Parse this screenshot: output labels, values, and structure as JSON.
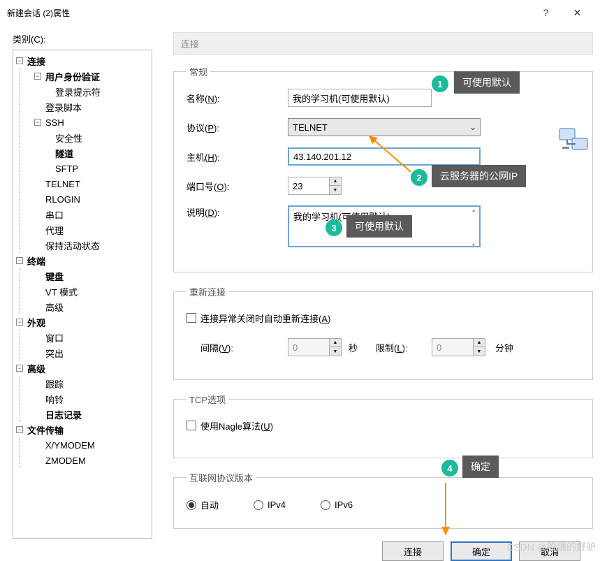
{
  "window": {
    "title": "新建会话 (2)属性",
    "help": "?",
    "close": "✕"
  },
  "category_label": "类别(C):",
  "tree": {
    "connection": "连接",
    "auth": "用户身份验证",
    "login_prompt": "登录提示符",
    "login_script": "登录脚本",
    "ssh": "SSH",
    "security": "安全性",
    "tunnel": "隧道",
    "sftp": "SFTP",
    "telnet": "TELNET",
    "rlogin": "RLOGIN",
    "serial": "串口",
    "proxy": "代理",
    "keepalive": "保持活动状态",
    "terminal": "终端",
    "keyboard": "键盘",
    "vtmode": "VT 模式",
    "advanced_t": "高级",
    "appearance": "外观",
    "window": "窗口",
    "highlight": "突出",
    "advanced": "高级",
    "trace": "跟踪",
    "bell": "响铃",
    "logging": "日志记录",
    "filetransfer": "文件传输",
    "xymodem": "X/YMODEM",
    "zmodem": "ZMODEM"
  },
  "panel": {
    "title": "连接"
  },
  "general": {
    "legend": "常规",
    "name_label": "名称(N):",
    "name_value": "我的学习机(可使用默认)",
    "protocol_label": "协议(P):",
    "protocol_value": "TELNET",
    "host_label": "主机(H):",
    "host_value": "43.140.201.12",
    "port_label": "端口号(O):",
    "port_value": "23",
    "desc_label": "说明(D):",
    "desc_value": "我的学习机(可使用默认)"
  },
  "reconnect": {
    "legend": "重新连接",
    "auto_label": "连接异常关闭时自动重新连接(A)",
    "interval_label": "间隔(V):",
    "interval_value": "0",
    "sec": "秒",
    "limit_label": "限制(L):",
    "limit_value": "0",
    "min": "分钟"
  },
  "tcp": {
    "legend": "TCP选项",
    "nagle_label": "使用Nagle算法(U)"
  },
  "ipv": {
    "legend": "互联网协议版本",
    "auto": "自动",
    "v4": "IPv4",
    "v6": "IPv6"
  },
  "buttons": {
    "connect": "连接",
    "ok": "确定",
    "cancel": "取消"
  },
  "annotations": {
    "n1": "1",
    "t1": "可使用默认",
    "n2": "2",
    "t2": "云服务器的公网IP",
    "n3": "3",
    "t3": "可使用默认",
    "n4": "4",
    "t4": "确定"
  },
  "watermark": "CSDN @脱缰的野驴"
}
